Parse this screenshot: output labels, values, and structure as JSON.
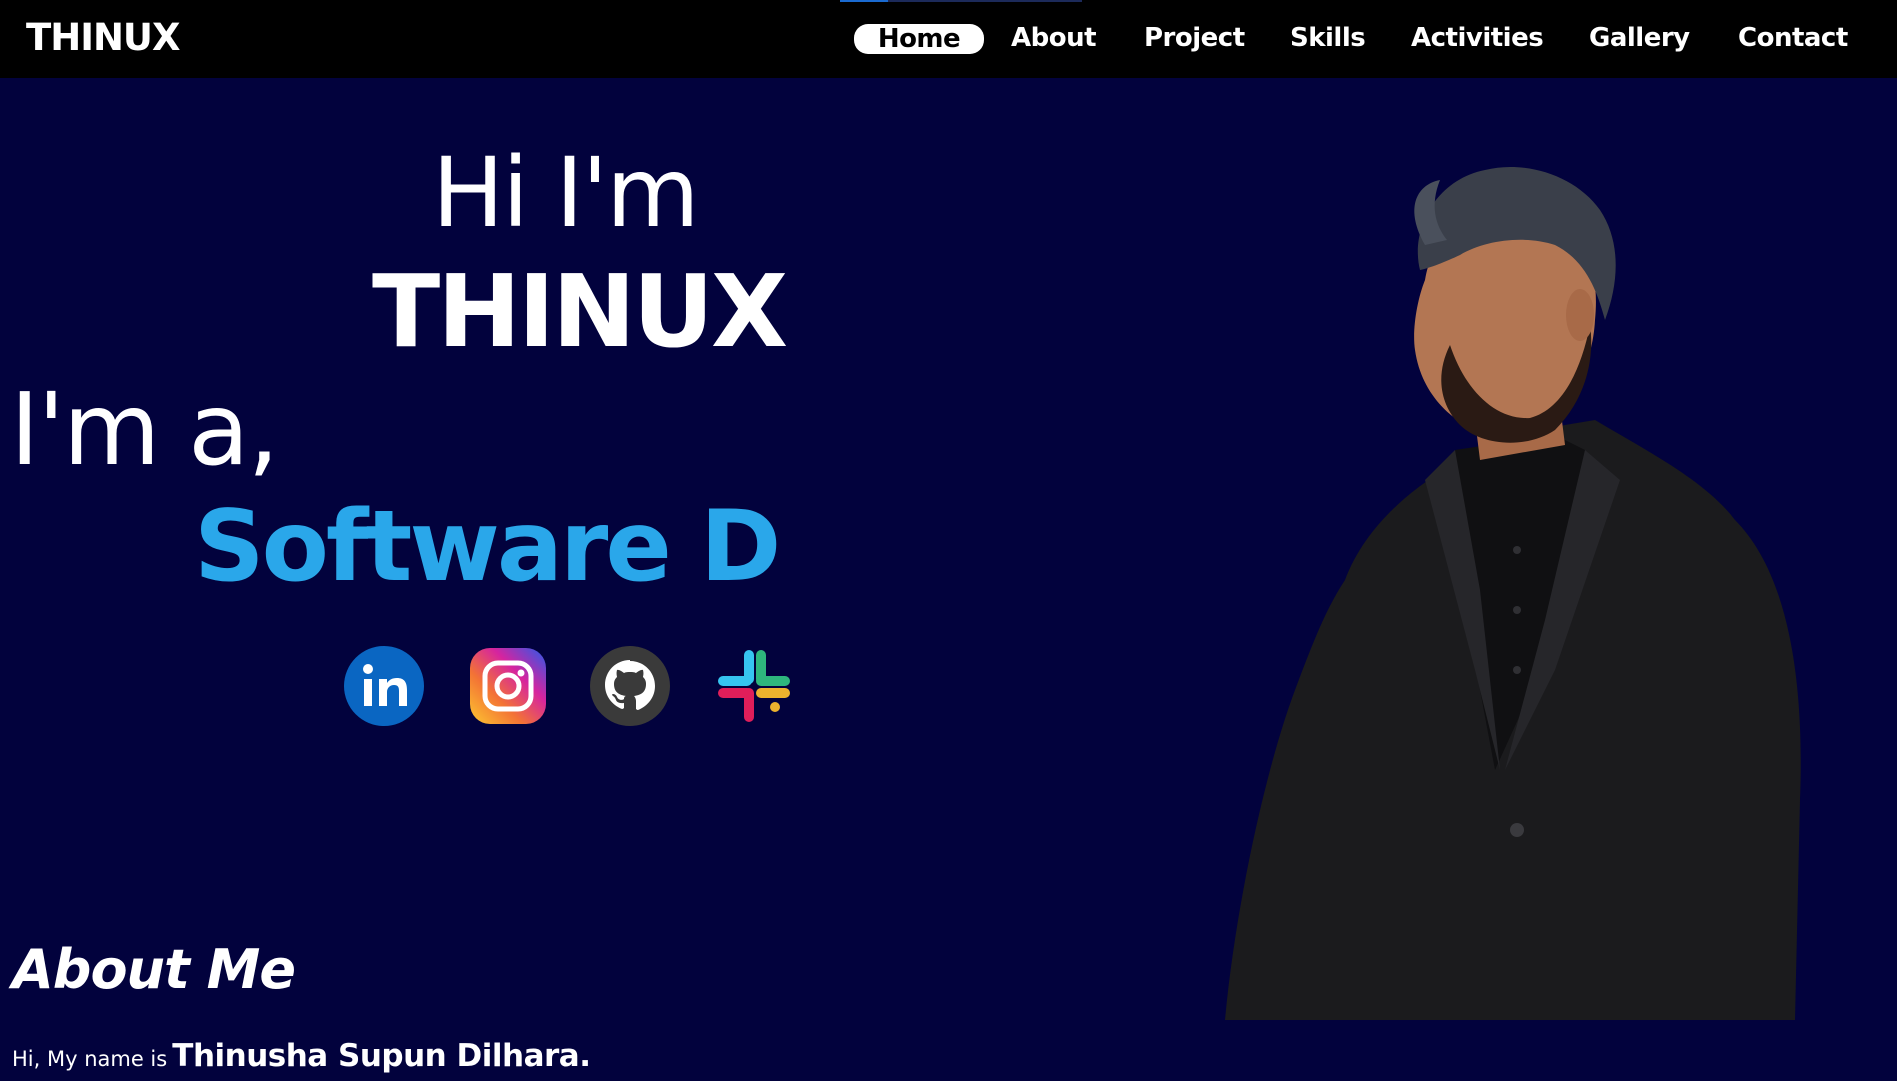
{
  "navbar": {
    "brand": "THINUX",
    "items": [
      {
        "label": "Home",
        "active": true
      },
      {
        "label": "About",
        "active": false
      },
      {
        "label": "Project",
        "active": false
      },
      {
        "label": "Skills",
        "active": false
      },
      {
        "label": "Activities",
        "active": false
      },
      {
        "label": "Gallery",
        "active": false
      },
      {
        "label": "Contact",
        "active": false
      }
    ]
  },
  "hero": {
    "greeting": "Hi I'm",
    "name": "THINUX",
    "intro": "I'm a,",
    "role": "Software D",
    "role_color": "#2aa7ea"
  },
  "social": [
    {
      "name": "linkedin-icon",
      "color": "#0a66c2"
    },
    {
      "name": "instagram-icon",
      "color": "#e1306c"
    },
    {
      "name": "github-icon",
      "color": "#333333"
    },
    {
      "name": "slack-icon",
      "color": "#4a154b"
    }
  ],
  "about": {
    "title": "About Me",
    "intro_prefix": "Hi, My name is",
    "full_name": "Thinusha Supun Dilhara."
  },
  "colors": {
    "background": "#02023d",
    "navbar": "#000000",
    "text": "#ffffff",
    "accent": "#2aa7ea"
  }
}
